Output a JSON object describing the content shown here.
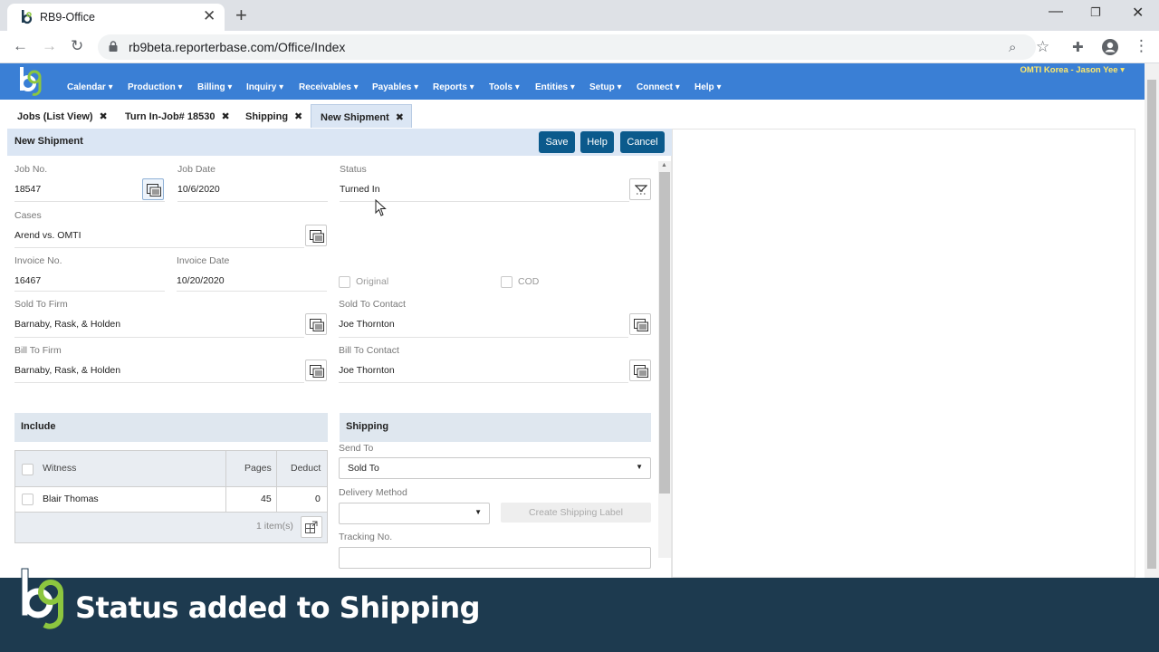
{
  "browser": {
    "tab_title": "RB9-Office",
    "url": "rb9beta.reporterbase.com/Office/Index"
  },
  "app": {
    "user_menu": "OMTI Korea - Jason Yee",
    "menu": [
      "Calendar",
      "Production",
      "Billing",
      "Inquiry",
      "Receivables",
      "Payables",
      "Reports",
      "Tools",
      "Entities",
      "Setup",
      "Connect",
      "Help"
    ]
  },
  "doc_tabs": [
    "Jobs (List View)",
    "Turn In-Job# 18530",
    "Shipping",
    "New Shipment"
  ],
  "panel": {
    "title": "New Shipment",
    "buttons": {
      "save": "Save",
      "help": "Help",
      "cancel": "Cancel"
    }
  },
  "form": {
    "job_no": {
      "label": "Job No.",
      "value": "18547"
    },
    "job_date": {
      "label": "Job Date",
      "value": "10/6/2020"
    },
    "status": {
      "label": "Status",
      "value": "Turned In"
    },
    "cases": {
      "label": "Cases",
      "value": "Arend vs. OMTI"
    },
    "invoice_no": {
      "label": "Invoice No.",
      "value": "16467"
    },
    "invoice_date": {
      "label": "Invoice Date",
      "value": "10/20/2020"
    },
    "original": {
      "label": "Original",
      "checked": false
    },
    "cod": {
      "label": "COD",
      "checked": false
    },
    "sold_to_firm": {
      "label": "Sold To Firm",
      "value": "Barnaby, Rask, & Holden"
    },
    "sold_to_contact": {
      "label": "Sold To Contact",
      "value": "Joe Thornton"
    },
    "bill_to_firm": {
      "label": "Bill To Firm",
      "value": "Barnaby, Rask, & Holden"
    },
    "bill_to_contact": {
      "label": "Bill To Contact",
      "value": "Joe Thornton"
    }
  },
  "include": {
    "title": "Include",
    "columns": [
      "Witness",
      "Pages",
      "Deduct"
    ],
    "rows": [
      {
        "witness": "Blair Thomas",
        "pages": "45",
        "deduct": "0"
      }
    ],
    "count": "1 item(s)"
  },
  "shipping": {
    "title": "Shipping",
    "send_to_label": "Send To",
    "send_to_value": "Sold To",
    "delivery_method_label": "Delivery Method",
    "delivery_method_value": "",
    "create_label_button": "Create Shipping Label",
    "tracking_no_label": "Tracking No."
  },
  "banner": {
    "text": "Status added to Shipping"
  },
  "colors": {
    "app_bar": "#3a7fd5",
    "button": "#0b5a8c",
    "banner": "#1d3a4f",
    "user_menu": "#ffe96b"
  }
}
